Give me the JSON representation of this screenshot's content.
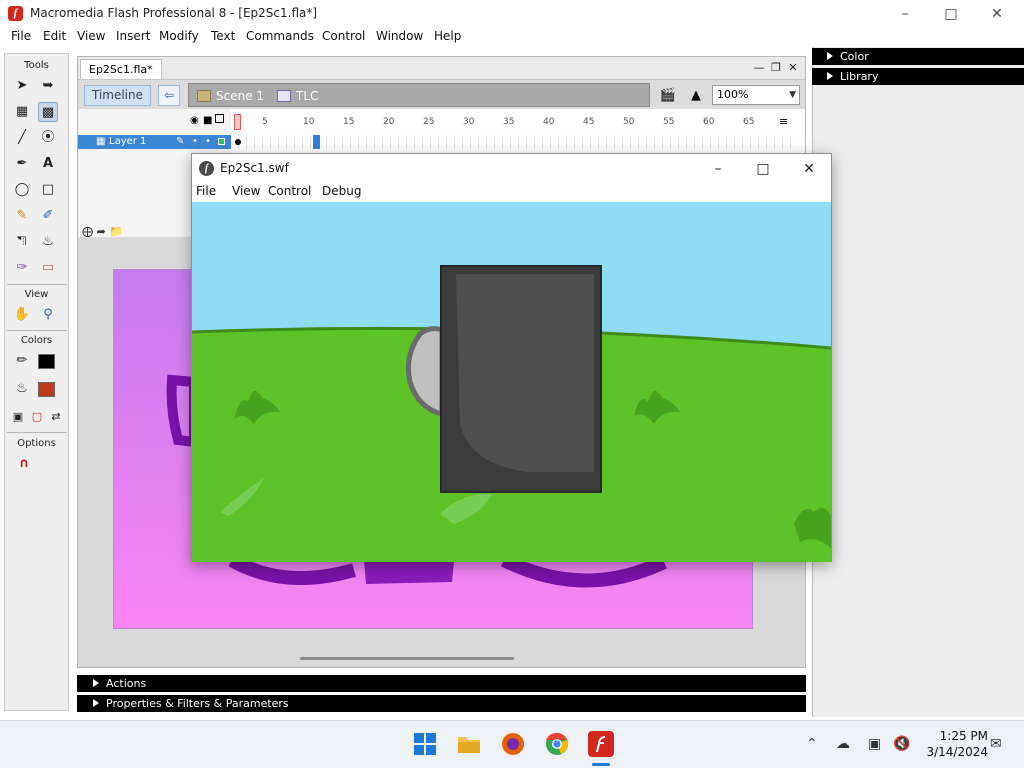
{
  "app": {
    "title": "Macromedia Flash Professional 8 - [Ep2Sc1.fla*]",
    "menu": [
      "File",
      "Edit",
      "View",
      "Insert",
      "Modify",
      "Text",
      "Commands",
      "Control",
      "Window",
      "Help"
    ]
  },
  "tools": {
    "tools_label": "Tools",
    "view_label": "View",
    "colors_label": "Colors",
    "options_label": "Options"
  },
  "panels": {
    "color": "Color",
    "library": "Library",
    "actions": "Actions",
    "properties": "Properties & Filters & Parameters"
  },
  "document": {
    "tab": "Ep2Sc1.fla*",
    "timeline_button": "Timeline",
    "scene": "Scene 1",
    "symbol": "TLC",
    "zoom": "100%",
    "layer": "Layer 1",
    "frame_ticks": [
      "5",
      "10",
      "15",
      "20",
      "25",
      "30",
      "35",
      "40",
      "45",
      "50",
      "55",
      "60",
      "65"
    ]
  },
  "player": {
    "title": "Ep2Sc1.swf",
    "menu": [
      "File",
      "View",
      "Control",
      "Debug"
    ]
  },
  "taskbar": {
    "time": "1:25 PM",
    "date": "3/14/2024"
  },
  "colors": {
    "stroke": "#000000",
    "fill": "#c0391b",
    "sky": "#8fdcf6",
    "grass": "#5cc227",
    "stage_top": "#c57cf0",
    "stage_bottom": "#f985f2"
  }
}
